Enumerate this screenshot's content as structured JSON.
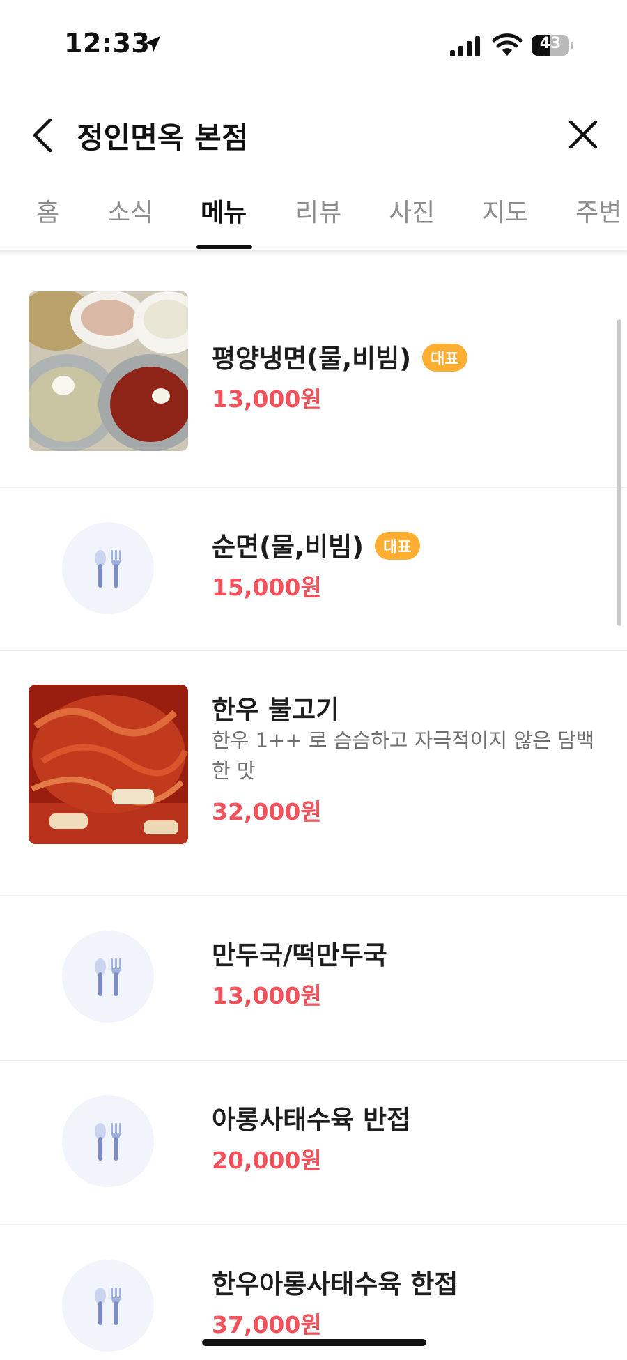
{
  "status_bar": {
    "time": "12:33",
    "battery": "43"
  },
  "header": {
    "title": "정인면옥 본점"
  },
  "tabs": [
    {
      "label": "홈",
      "active": false
    },
    {
      "label": "소식",
      "active": false
    },
    {
      "label": "메뉴",
      "active": true
    },
    {
      "label": "리뷰",
      "active": false
    },
    {
      "label": "사진",
      "active": false
    },
    {
      "label": "지도",
      "active": false
    },
    {
      "label": "주변",
      "active": false
    }
  ],
  "menu": {
    "items": [
      {
        "name": "평양냉면(물,비빔)",
        "badge": "대표",
        "price": "13,000원",
        "has_photo": true
      },
      {
        "name": "순면(물,비빔)",
        "badge": "대표",
        "price": "15,000원",
        "has_photo": false
      },
      {
        "name": "한우 불고기",
        "description": "한우 1++ 로 슴슴하고 자극적이지 않은 담백한 맛",
        "price": "32,000원",
        "has_photo": true
      },
      {
        "name": "만두국/떡만두국",
        "price": "13,000원",
        "has_photo": false
      },
      {
        "name": "아롱사태수육 반접",
        "price": "20,000원",
        "has_photo": false
      },
      {
        "name": "한우아롱사태수육 한접",
        "price": "37,000원",
        "has_photo": false
      }
    ]
  },
  "colors": {
    "price": "#f0515a",
    "badge": "#ffae32",
    "tab_active": "#111111",
    "tab_inactive": "#8e8e8e"
  },
  "icons": {
    "placeholder": "cutlery-icon",
    "back": "chevron-left-icon",
    "close": "close-icon"
  }
}
